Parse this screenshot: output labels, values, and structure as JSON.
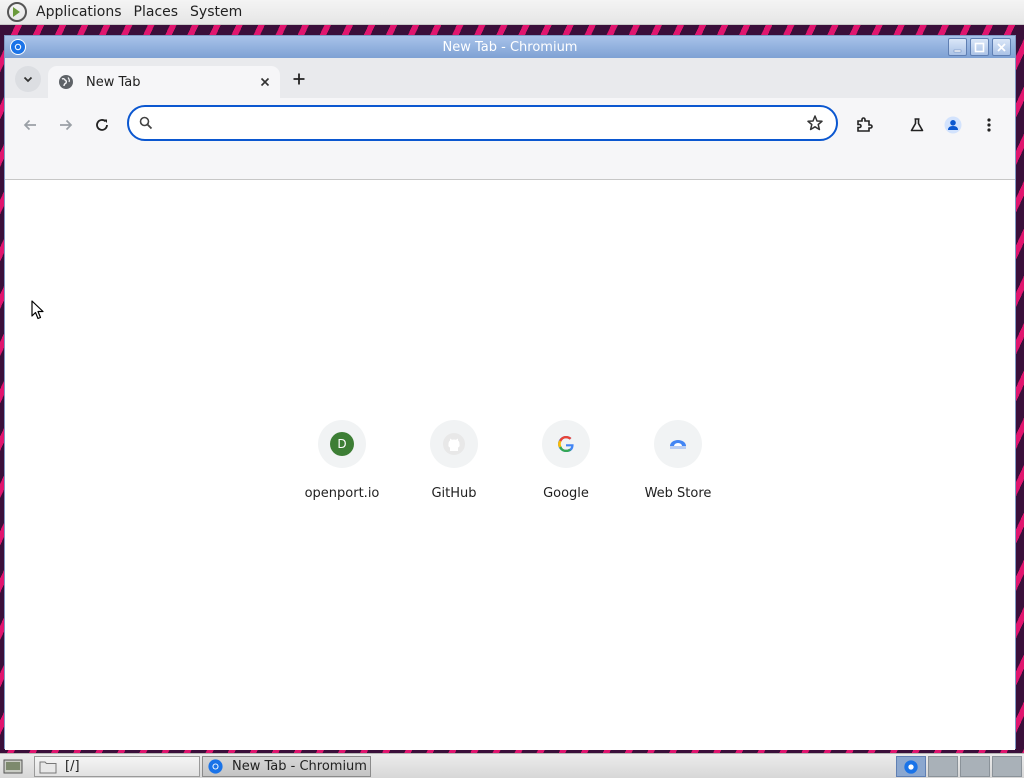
{
  "top_panel": {
    "menus": [
      "Applications",
      "Places",
      "System"
    ]
  },
  "window": {
    "title": "New Tab - Chromium"
  },
  "tabs": [
    {
      "label": "New Tab",
      "icon": "globe-icon"
    }
  ],
  "omnibox": {
    "value": "",
    "placeholder": ""
  },
  "shortcuts": [
    {
      "label": "openport.io",
      "icon": "letter-avatar",
      "letter": "D",
      "color": "#3d7e35"
    },
    {
      "label": "GitHub",
      "icon": "github-icon"
    },
    {
      "label": "Google",
      "icon": "google-icon"
    },
    {
      "label": "Web Store",
      "icon": "web-store-icon"
    }
  ],
  "taskbar": {
    "tasks": [
      {
        "label": "[/]",
        "icon": "folder-icon"
      },
      {
        "label": "New Tab - Chromium",
        "icon": "chromium-icon"
      }
    ]
  },
  "colors": {
    "accent": "#0b57d0",
    "titlebar": "#7ea1d4",
    "desktop_stripe": "#e0156e"
  }
}
